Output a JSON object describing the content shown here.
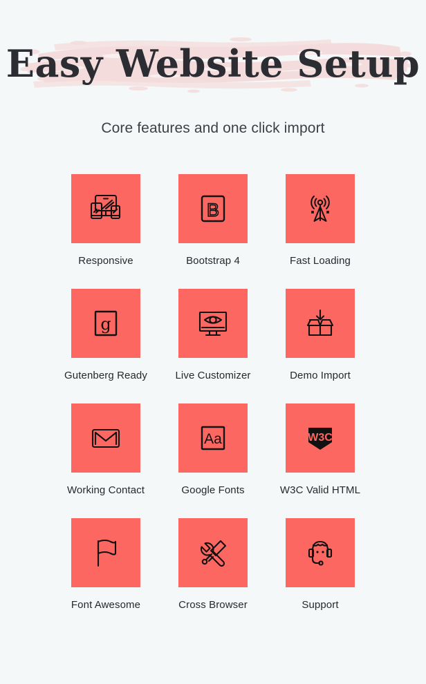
{
  "header": {
    "title": "Easy Website Setup",
    "subtitle": "Core features and one click import",
    "brush_color": "#f4dddd",
    "background_color": "#f5f8f8"
  },
  "theme": {
    "tile_color": "#fc6761",
    "icon_color": "#111111",
    "label_color": "#25282d"
  },
  "features": {
    "rows": [
      [
        {
          "label": "Responsive",
          "icon": "devices-responsive-icon"
        },
        {
          "label": "Bootstrap 4",
          "icon": "bootstrap-b-square-icon"
        },
        {
          "label": "Fast Loading",
          "icon": "broadcast-tower-icon"
        }
      ],
      [
        {
          "label": "Gutenberg Ready",
          "icon": "gutenberg-g-square-icon"
        },
        {
          "label": "Live Customizer",
          "icon": "monitor-eye-icon"
        },
        {
          "label": "Demo Import",
          "icon": "box-download-icon"
        }
      ],
      [
        {
          "label": "Working Contact",
          "icon": "envelope-icon"
        },
        {
          "label": "Google Fonts",
          "icon": "typography-aa-square-icon"
        },
        {
          "label": "W3C Valid HTML",
          "icon": "w3c-shield-icon"
        }
      ],
      [
        {
          "label": "Font Awesome",
          "icon": "flag-icon"
        },
        {
          "label": "Cross Browser",
          "icon": "wrench-screwdriver-icon"
        },
        {
          "label": "Support",
          "icon": "headset-icon"
        }
      ]
    ]
  },
  "icon_badges": {
    "bootstrap_letter": "B",
    "gutenberg_letter": "g",
    "fonts_letters": "Aa",
    "w3c_letters": "W3C"
  }
}
